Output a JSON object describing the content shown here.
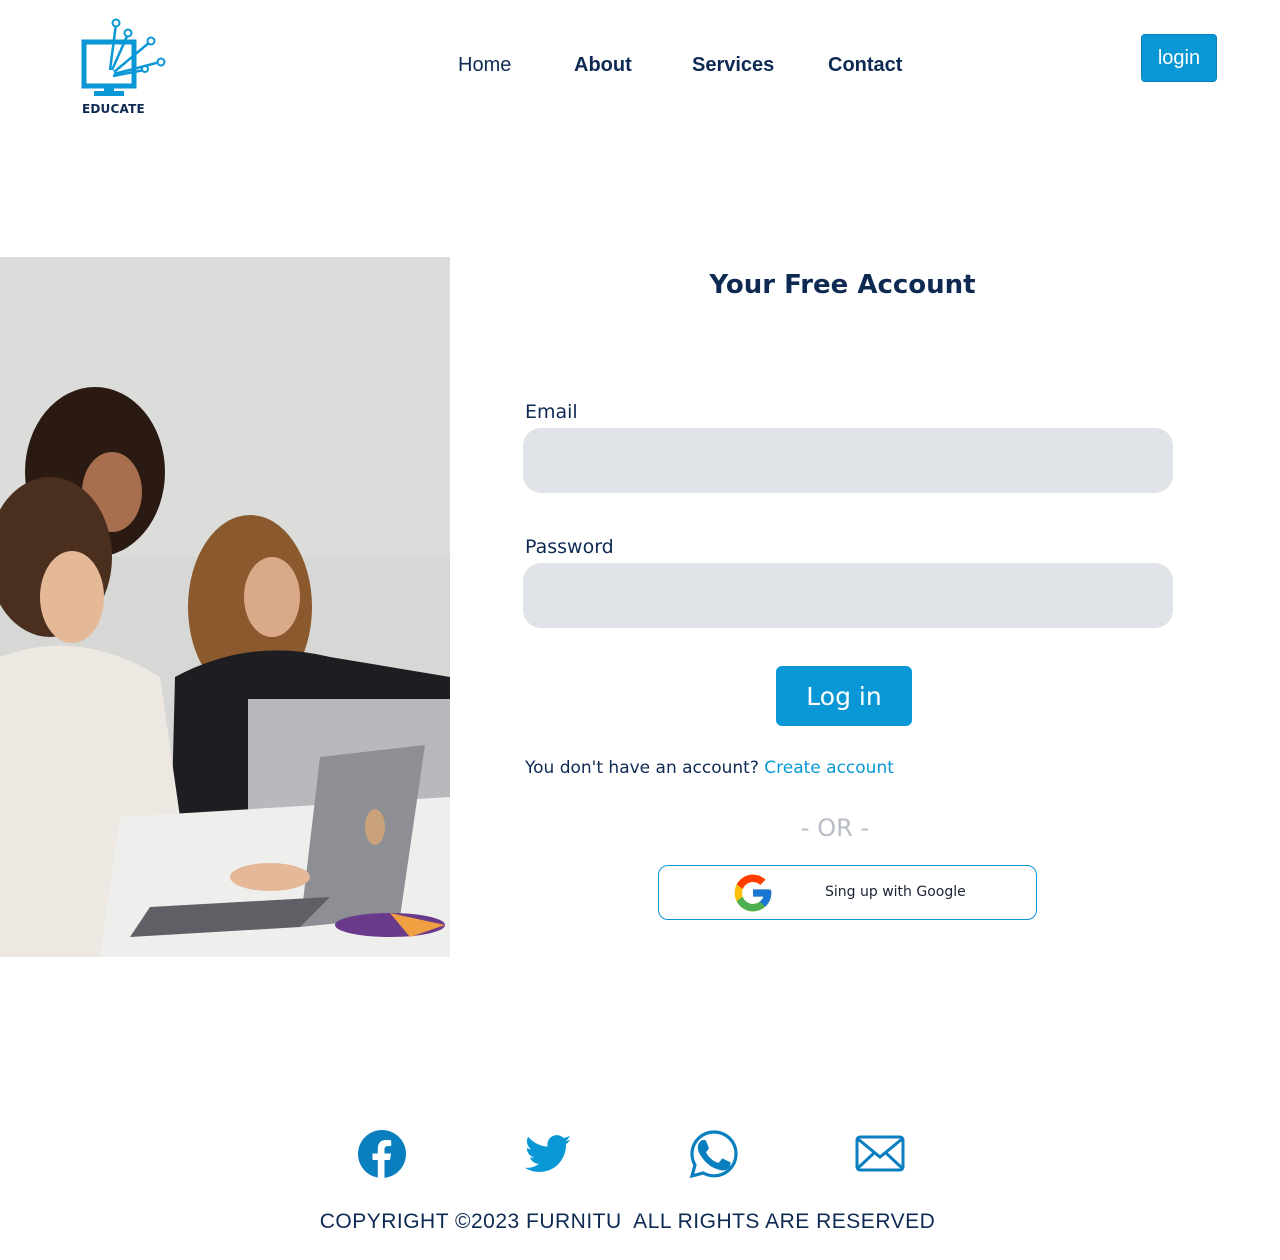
{
  "brand": {
    "logo_text": "EDUCATE",
    "accent": "#0a97d6",
    "primary_text": "#0e2a52"
  },
  "nav": {
    "items": [
      {
        "label": "Home"
      },
      {
        "label": "About"
      },
      {
        "label": "Services"
      },
      {
        "label": "Contact"
      }
    ],
    "login_label": "login"
  },
  "form": {
    "title": "Your Free Account",
    "email_label": "Email",
    "email_value": "",
    "password_label": "Password",
    "password_value": "",
    "submit_label": "Log in",
    "no_account_text": "You don't have an account?",
    "create_account_label": "Create account",
    "or_text": "- OR -",
    "google_label": "Sing up with Google"
  },
  "footer": {
    "social_icons": [
      "facebook-icon",
      "twitter-icon",
      "whatsapp-icon",
      "mail-icon"
    ],
    "copyright": "COPYRIGHT ©2023 FURNITU  ALL RIGHTS ARE RESERVED"
  }
}
